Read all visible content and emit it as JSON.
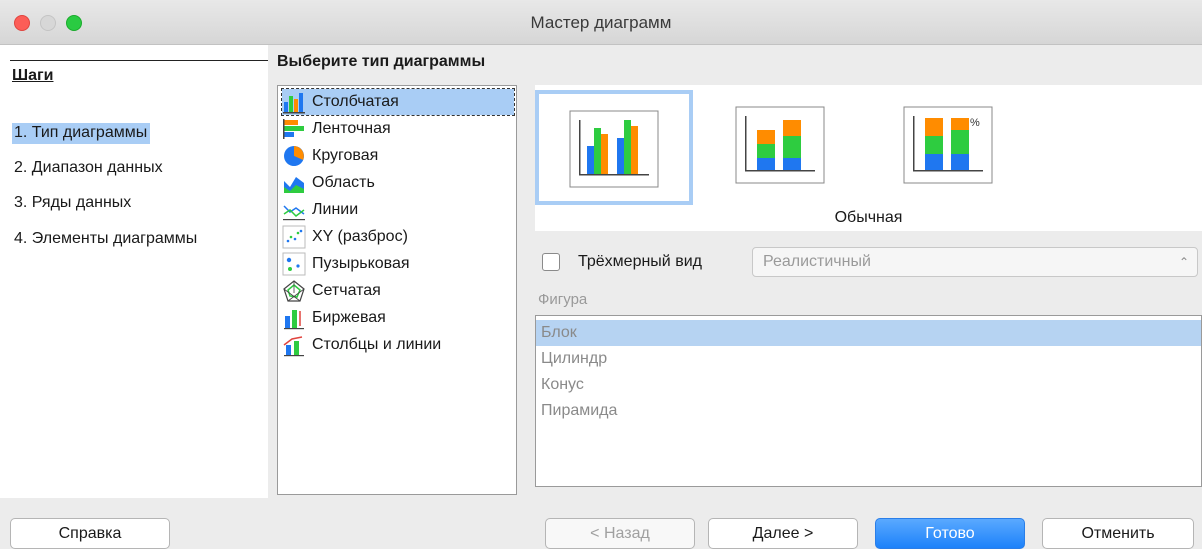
{
  "window": {
    "title": "Мастер диаграмм"
  },
  "sidebar": {
    "heading": "Шаги",
    "steps": [
      {
        "label": "1. Тип диаграммы",
        "active": true
      },
      {
        "label": "2. Диапазон данных",
        "active": false
      },
      {
        "label": "3. Ряды данных",
        "active": false
      },
      {
        "label": "4. Элементы диаграммы",
        "active": false
      }
    ]
  },
  "main": {
    "title": "Выберите тип диаграммы",
    "chart_types": [
      {
        "label": "Столбчатая",
        "icon": "column-chart-icon",
        "selected": true
      },
      {
        "label": "Ленточная",
        "icon": "bar-chart-icon"
      },
      {
        "label": "Круговая",
        "icon": "pie-chart-icon"
      },
      {
        "label": "Область",
        "icon": "area-chart-icon"
      },
      {
        "label": "Линии",
        "icon": "line-chart-icon"
      },
      {
        "label": "XY (разброс)",
        "icon": "scatter-chart-icon"
      },
      {
        "label": "Пузырьковая",
        "icon": "bubble-chart-icon"
      },
      {
        "label": "Сетчатая",
        "icon": "net-chart-icon"
      },
      {
        "label": "Биржевая",
        "icon": "stock-chart-icon"
      },
      {
        "label": "Столбцы и линии",
        "icon": "column-line-chart-icon"
      }
    ],
    "variants": [
      {
        "icon": "normal-column-icon",
        "selected": true
      },
      {
        "icon": "stacked-column-icon"
      },
      {
        "icon": "percent-stacked-column-icon",
        "symbol": "%"
      }
    ],
    "variant_label": "Обычная",
    "three_d": {
      "label": "Трёхмерный вид",
      "checked": false,
      "select_value": "Реалистичный"
    },
    "shape": {
      "label": "Фигура",
      "options": [
        {
          "label": "Блок",
          "selected": true
        },
        {
          "label": "Цилиндр"
        },
        {
          "label": "Конус"
        },
        {
          "label": "Пирамида"
        }
      ]
    },
    "colors": {
      "blue": "#1f77f0",
      "green": "#2ecc40",
      "orange": "#ff8c00",
      "selection": "#a9cdf5"
    }
  },
  "buttons": {
    "help": "Справка",
    "back": "< Назад",
    "next": "Далее >",
    "finish": "Готово",
    "cancel": "Отменить"
  }
}
